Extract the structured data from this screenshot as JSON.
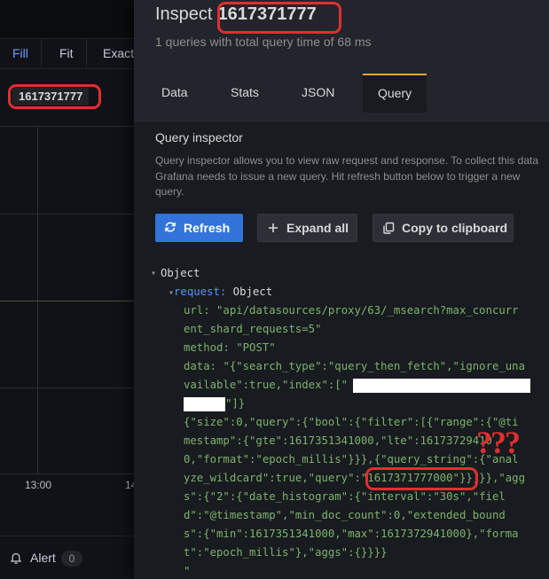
{
  "panel": {
    "tabs": [
      "Fill",
      "Fit",
      "Exact"
    ],
    "active_tab": "Fill",
    "value_label": "1617371777",
    "x_ticks": [
      "13:00",
      "14"
    ],
    "alert_label": "Alert",
    "alert_count": "0"
  },
  "inspect": {
    "title_prefix": "Inspect",
    "title_id": "1617371777",
    "subtitle": "1 queries with total query time of 68 ms",
    "tabs": [
      "Data",
      "Stats",
      "JSON",
      "Query"
    ],
    "active_tab": "Query"
  },
  "query_inspector": {
    "title": "Query inspector",
    "description": "Query inspector allows you to view raw request and response. To collect this data Grafana needs to issue a new query. Hit refresh button below to trigger a new query.",
    "refresh_label": "Refresh",
    "expand_label": "Expand all",
    "copy_label": "Copy to clipboard"
  },
  "object_tree": {
    "root": "Object",
    "request_key": "request:",
    "request_type": "Object",
    "url_key": "url:",
    "url_line1": "\"api/datasources/proxy/63/_msearch?max_concurr",
    "url_line2": "ent_shard_requests=5\"",
    "method_key": "method:",
    "method_value": "\"POST\"",
    "data_key": "data:",
    "data_lines": [
      "\"{\"search_type\":\"query_then_fetch\",\"ignore_una",
      "vailable\":true,\"index\":[\"",
      "\"]}",
      "{\"size\":0,\"query\":{\"bool\":{\"filter\":[{\"range\":{\"@ti",
      "mestamp\":{\"gte\":1617351341000,\"lte\":16173729410",
      "0,\"format\":\"epoch_millis\"}}},{\"query_string\":{\"anal",
      "yze_wildcard\":true,\"query\":",
      "\"1617371777000\"",
      "}}]}},\"agg",
      "s\":{\"2\":{\"date_histogram\":{\"interval\":\"30s\",\"fiel",
      "d\":\"@timestamp\",\"min_doc_count\":0,\"extended_bound",
      "s\":{\"min\":1617351341000,\"max\":1617372941000},\"forma",
      "t\":\"epoch_millis\"},\"aggs\":{}}}}",
      "\""
    ]
  },
  "annotation_text": "???",
  "colors": {
    "annotation": "#e02f2f",
    "primary_button": "#3274d9",
    "active_tab_border": "#f2a33b",
    "json_string": "#7eb26d",
    "json_key_request": "#5794f2"
  }
}
